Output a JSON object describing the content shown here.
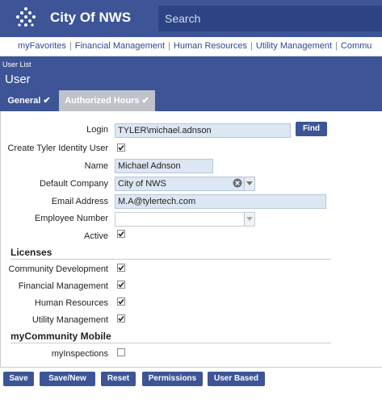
{
  "app": {
    "title": "City Of NWS",
    "search_placeholder": "Search"
  },
  "nav": {
    "items": [
      "myFavorites",
      "Financial Management",
      "Human Resources",
      "Utility Management",
      "Commu"
    ]
  },
  "header": {
    "breadcrumb": "User List",
    "title": "User"
  },
  "tabs": [
    {
      "label": "General",
      "active": true
    },
    {
      "label": "Authorized Hours",
      "active": false
    }
  ],
  "form": {
    "login": {
      "label": "Login",
      "value": "TYLER\\michael.adnson",
      "find_label": "Find"
    },
    "create_identity": {
      "label": "Create Tyler Identity User",
      "checked": true
    },
    "name": {
      "label": "Name",
      "value": "Michael Adnson"
    },
    "default_company": {
      "label": "Default Company",
      "value": "City of NWS"
    },
    "email": {
      "label": "Email Address",
      "value": "M.A@tylertech.com"
    },
    "employee_number": {
      "label": "Employee Number",
      "value": ""
    },
    "active": {
      "label": "Active",
      "checked": true
    }
  },
  "licenses": {
    "title": "Licenses",
    "items": [
      {
        "label": "Community Development",
        "checked": true
      },
      {
        "label": "Financial Management",
        "checked": true
      },
      {
        "label": "Human Resources",
        "checked": true
      },
      {
        "label": "Utility Management",
        "checked": true
      }
    ]
  },
  "mobile": {
    "title": "myCommunity Mobile",
    "items": [
      {
        "label": "myInspections",
        "checked": false
      }
    ]
  },
  "buttons": {
    "save": "Save",
    "save_new": "Save/New",
    "reset": "Reset",
    "permissions": "Permissions",
    "user_based": "User Based"
  },
  "colors": {
    "brand": "#3d5596",
    "field_bg": "#dde7f3",
    "tab_inactive": "#bfc3c9"
  }
}
